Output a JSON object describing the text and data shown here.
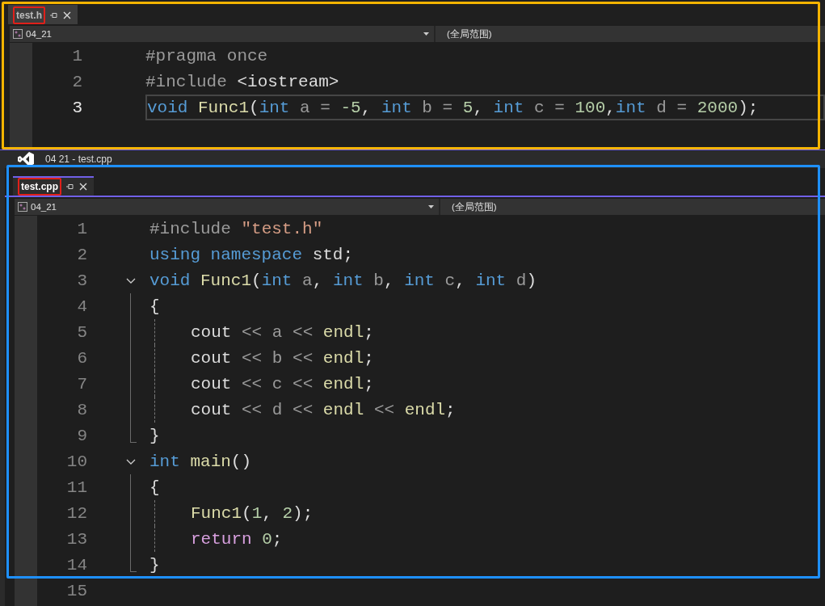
{
  "panes": [
    {
      "color": "#f5b400",
      "tab": {
        "label": "test.h",
        "marked": true,
        "focused": false
      },
      "nav": {
        "project": "04_21",
        "scope": "(全局范围)"
      },
      "lines": [
        {
          "number": "1",
          "current": false,
          "tokens": [
            {
              "text": "#pragma once",
              "kind": "preproc"
            }
          ]
        },
        {
          "number": "2",
          "current": false,
          "tokens": [
            {
              "text": "#include ",
              "kind": "preproc"
            },
            {
              "text": "<iostream>",
              "kind": "plain"
            }
          ]
        },
        {
          "number": "3",
          "current": true,
          "tokens": [
            {
              "text": "void ",
              "kind": "keyword"
            },
            {
              "text": "Func1",
              "kind": "func"
            },
            {
              "text": "(",
              "kind": "plain"
            },
            {
              "text": "int ",
              "kind": "keyword"
            },
            {
              "text": "a = ",
              "kind": "param"
            },
            {
              "text": "-5",
              "kind": "number"
            },
            {
              "text": ", ",
              "kind": "plain"
            },
            {
              "text": "int ",
              "kind": "keyword"
            },
            {
              "text": "b = ",
              "kind": "param"
            },
            {
              "text": "5",
              "kind": "number"
            },
            {
              "text": ", ",
              "kind": "plain"
            },
            {
              "text": "int ",
              "kind": "keyword"
            },
            {
              "text": "c = ",
              "kind": "param"
            },
            {
              "text": "100",
              "kind": "number"
            },
            {
              "text": ",",
              "kind": "plain"
            },
            {
              "text": "int ",
              "kind": "keyword"
            },
            {
              "text": "d = ",
              "kind": "param"
            },
            {
              "text": "2000",
              "kind": "number"
            },
            {
              "text": ");",
              "kind": "plain"
            }
          ]
        }
      ]
    },
    {
      "color": "#1e90ff",
      "tab": {
        "label": "test.cpp",
        "marked": true,
        "focused": true
      },
      "nav": {
        "project": "04_21",
        "scope": "(全局范围)"
      },
      "lines": [
        {
          "number": "1",
          "collapsible": false,
          "in_block": false,
          "block_end": false,
          "guide": false,
          "tokens": [
            {
              "text": "#include ",
              "kind": "preproc"
            },
            {
              "text": "\"test.h\"",
              "kind": "string"
            }
          ]
        },
        {
          "number": "2",
          "collapsible": false,
          "in_block": false,
          "block_end": false,
          "guide": false,
          "tokens": [
            {
              "text": "using namespace ",
              "kind": "keyword"
            },
            {
              "text": "std;",
              "kind": "plain"
            }
          ]
        },
        {
          "number": "3",
          "collapsible": true,
          "in_block": false,
          "block_end": false,
          "guide": false,
          "tokens": [
            {
              "text": "void ",
              "kind": "keyword"
            },
            {
              "text": "Func1",
              "kind": "func"
            },
            {
              "text": "(",
              "kind": "plain"
            },
            {
              "text": "int ",
              "kind": "keyword"
            },
            {
              "text": "a",
              "kind": "param"
            },
            {
              "text": ", ",
              "kind": "plain"
            },
            {
              "text": "int ",
              "kind": "keyword"
            },
            {
              "text": "b",
              "kind": "param"
            },
            {
              "text": ", ",
              "kind": "plain"
            },
            {
              "text": "int ",
              "kind": "keyword"
            },
            {
              "text": "c",
              "kind": "param"
            },
            {
              "text": ", ",
              "kind": "plain"
            },
            {
              "text": "int ",
              "kind": "keyword"
            },
            {
              "text": "d",
              "kind": "param"
            },
            {
              "text": ")",
              "kind": "plain"
            }
          ]
        },
        {
          "number": "4",
          "collapsible": false,
          "in_block": true,
          "block_end": false,
          "guide": false,
          "tokens": [
            {
              "text": "{",
              "kind": "plain"
            }
          ]
        },
        {
          "number": "5",
          "collapsible": false,
          "in_block": true,
          "block_end": false,
          "guide": true,
          "tokens": [
            {
              "text": "cout ",
              "kind": "plain"
            },
            {
              "text": "<< ",
              "kind": "param"
            },
            {
              "text": "a ",
              "kind": "param"
            },
            {
              "text": "<< ",
              "kind": "param"
            },
            {
              "text": "endl",
              "kind": "func"
            },
            {
              "text": ";",
              "kind": "plain"
            }
          ]
        },
        {
          "number": "6",
          "collapsible": false,
          "in_block": true,
          "block_end": false,
          "guide": true,
          "tokens": [
            {
              "text": "cout ",
              "kind": "plain"
            },
            {
              "text": "<< ",
              "kind": "param"
            },
            {
              "text": "b ",
              "kind": "param"
            },
            {
              "text": "<< ",
              "kind": "param"
            },
            {
              "text": "endl",
              "kind": "func"
            },
            {
              "text": ";",
              "kind": "plain"
            }
          ]
        },
        {
          "number": "7",
          "collapsible": false,
          "in_block": true,
          "block_end": false,
          "guide": true,
          "tokens": [
            {
              "text": "cout ",
              "kind": "plain"
            },
            {
              "text": "<< ",
              "kind": "param"
            },
            {
              "text": "c ",
              "kind": "param"
            },
            {
              "text": "<< ",
              "kind": "param"
            },
            {
              "text": "endl",
              "kind": "func"
            },
            {
              "text": ";",
              "kind": "plain"
            }
          ]
        },
        {
          "number": "8",
          "collapsible": false,
          "in_block": true,
          "block_end": false,
          "guide": true,
          "tokens": [
            {
              "text": "cout ",
              "kind": "plain"
            },
            {
              "text": "<< ",
              "kind": "param"
            },
            {
              "text": "d ",
              "kind": "param"
            },
            {
              "text": "<< ",
              "kind": "param"
            },
            {
              "text": "endl ",
              "kind": "func"
            },
            {
              "text": "<< ",
              "kind": "param"
            },
            {
              "text": "endl",
              "kind": "func"
            },
            {
              "text": ";",
              "kind": "plain"
            }
          ]
        },
        {
          "number": "9",
          "collapsible": false,
          "in_block": false,
          "block_end": true,
          "guide": false,
          "tokens": [
            {
              "text": "}",
              "kind": "plain"
            }
          ]
        },
        {
          "number": "10",
          "collapsible": true,
          "in_block": false,
          "block_end": false,
          "guide": false,
          "tokens": [
            {
              "text": "int ",
              "kind": "keyword"
            },
            {
              "text": "main",
              "kind": "func"
            },
            {
              "text": "()",
              "kind": "plain"
            }
          ]
        },
        {
          "number": "11",
          "collapsible": false,
          "in_block": true,
          "block_end": false,
          "guide": false,
          "tokens": [
            {
              "text": "{",
              "kind": "plain"
            }
          ]
        },
        {
          "number": "12",
          "collapsible": false,
          "in_block": true,
          "block_end": false,
          "guide": true,
          "tokens": [
            {
              "text": "Func1",
              "kind": "func"
            },
            {
              "text": "(",
              "kind": "plain"
            },
            {
              "text": "1",
              "kind": "number"
            },
            {
              "text": ", ",
              "kind": "plain"
            },
            {
              "text": "2",
              "kind": "number"
            },
            {
              "text": ");",
              "kind": "plain"
            }
          ]
        },
        {
          "number": "13",
          "collapsible": false,
          "in_block": true,
          "block_end": false,
          "guide": true,
          "tokens": [
            {
              "text": "return ",
              "kind": "control"
            },
            {
              "text": "0",
              "kind": "number"
            },
            {
              "text": ";",
              "kind": "plain"
            }
          ]
        },
        {
          "number": "14",
          "collapsible": false,
          "in_block": false,
          "block_end": true,
          "guide": false,
          "tokens": [
            {
              "text": "}",
              "kind": "plain"
            }
          ]
        },
        {
          "number": "15",
          "collapsible": false,
          "in_block": false,
          "block_end": false,
          "guide": false
        }
      ]
    }
  ],
  "title_bar": {
    "title": "04 21 - test.cpp"
  }
}
